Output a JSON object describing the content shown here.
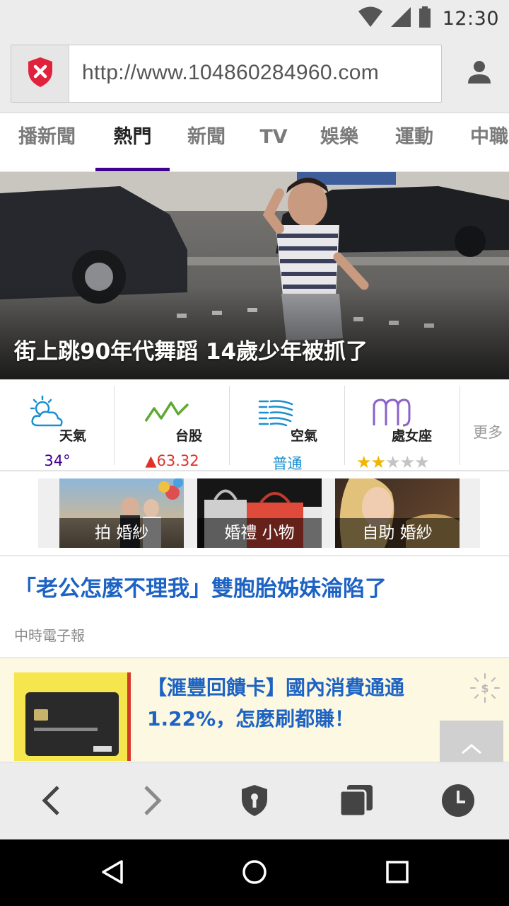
{
  "status_bar": {
    "time": "12:30",
    "icons": [
      "wifi-icon",
      "cell-signal-icon",
      "battery-icon"
    ]
  },
  "url_bar": {
    "url": "http://www.104860284960.com"
  },
  "tabs": [
    {
      "label": "播新聞",
      "active": false
    },
    {
      "label": "熱門",
      "active": true
    },
    {
      "label": "新聞",
      "active": false
    },
    {
      "label": "TV",
      "active": false
    },
    {
      "label": "娛樂",
      "active": false
    },
    {
      "label": "運動",
      "active": false
    },
    {
      "label": "中職",
      "active": false
    }
  ],
  "hero": {
    "title": "街上跳90年代舞蹈 14歲少年被抓了"
  },
  "widgets": {
    "weather": {
      "label": "天氣",
      "value": "34°",
      "color": "#400090"
    },
    "stock": {
      "label": "台股",
      "value": "63.32",
      "direction": "up",
      "color": "#e0312a"
    },
    "air": {
      "label": "空氣",
      "value": "普通",
      "color": "#1a8fd0"
    },
    "horoscope": {
      "label": "處女座",
      "stars": 2,
      "max_stars": 5
    },
    "more": {
      "label": "更多"
    }
  },
  "thumbs": [
    {
      "caption": "拍 婚紗"
    },
    {
      "caption": "婚禮 小物"
    },
    {
      "caption": "自助 婚紗"
    }
  ],
  "article": {
    "title": "「老公怎麼不理我」雙胞胎姊妹淪陷了",
    "source": "中時電子報"
  },
  "ad": {
    "text": "【滙豐回饋卡】國內消費通通 1.22%，怎麼刷都賺！"
  },
  "colors": {
    "accent": "#400090",
    "link": "#1d63c4",
    "shield": "#e0223c"
  }
}
